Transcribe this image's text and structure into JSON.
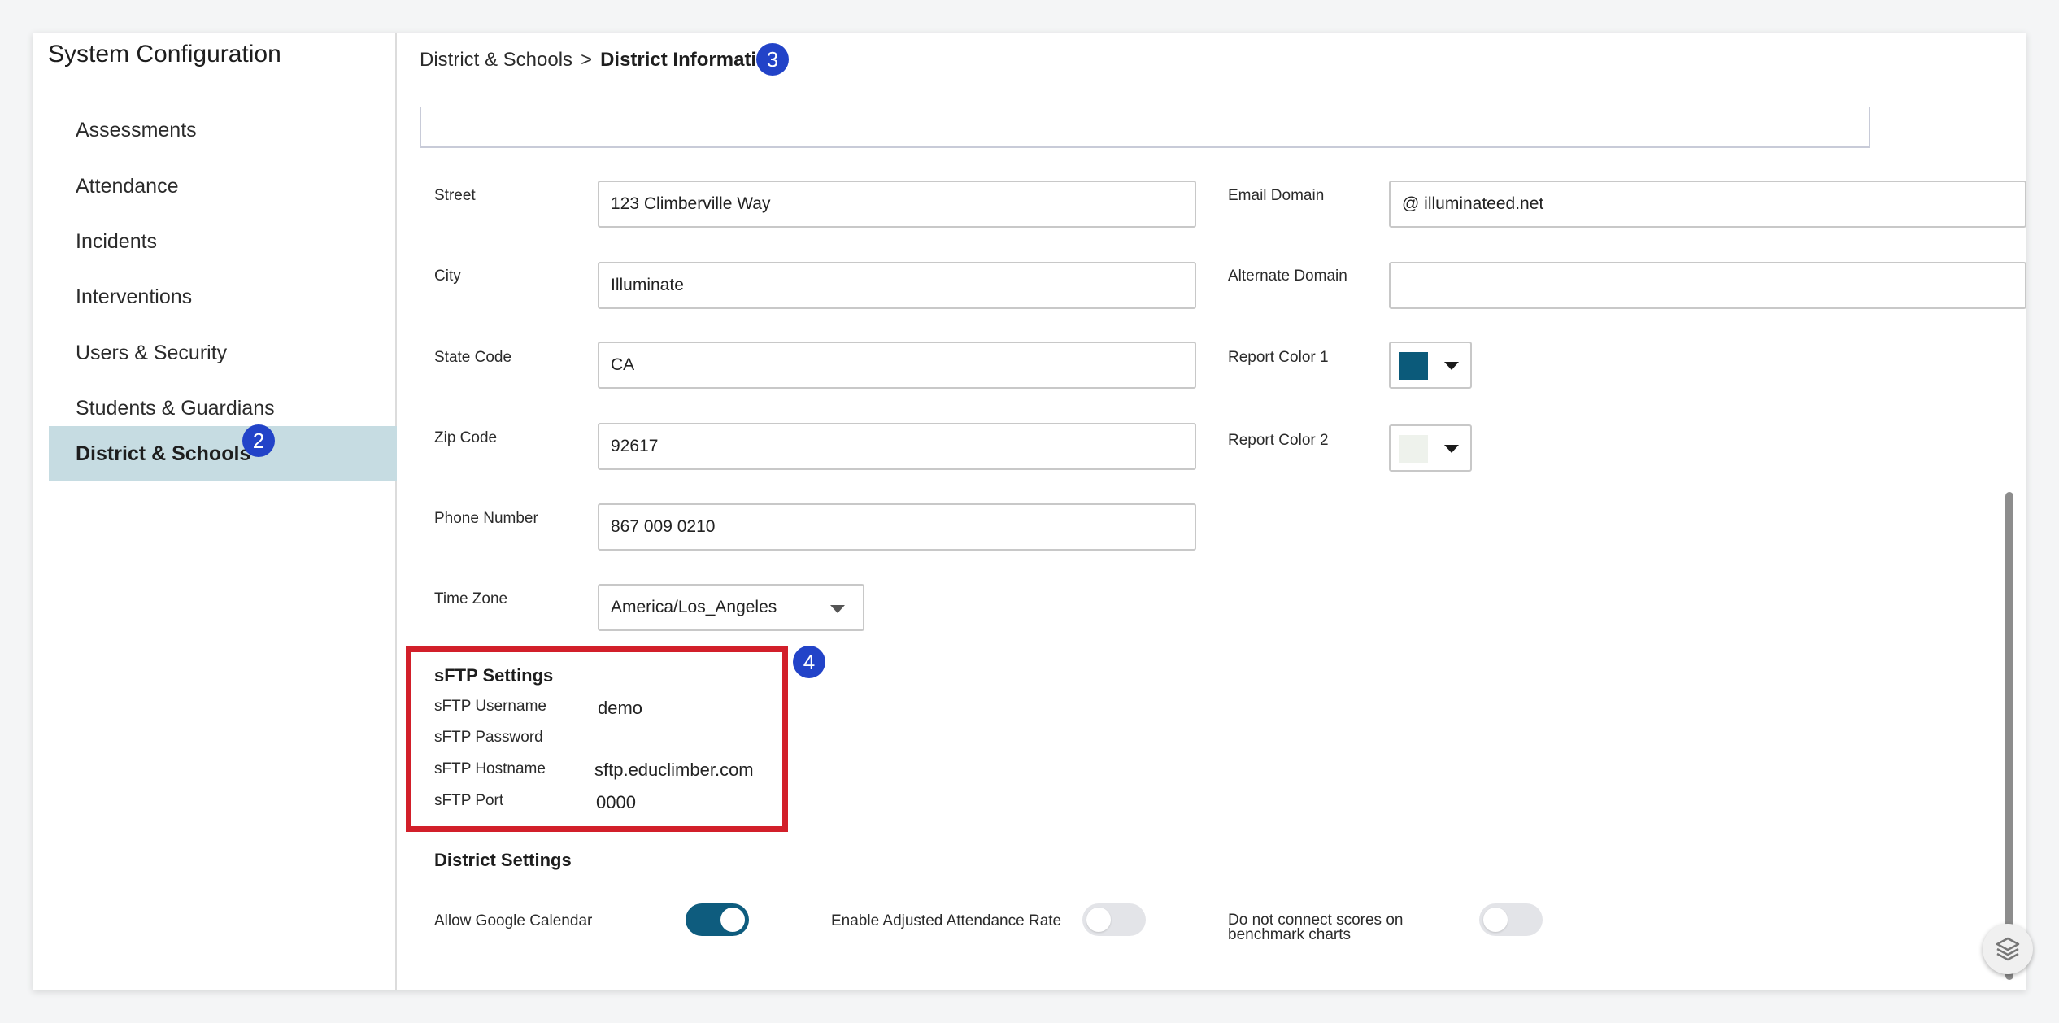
{
  "sidebar": {
    "title": "System Configuration",
    "items": [
      {
        "label": "Assessments"
      },
      {
        "label": "Attendance"
      },
      {
        "label": "Incidents"
      },
      {
        "label": "Interventions"
      },
      {
        "label": "Users & Security"
      },
      {
        "label": "Students & Guardians"
      },
      {
        "label": "District & Schools",
        "active": true,
        "badge": "2"
      }
    ]
  },
  "breadcrumb": {
    "parent": "District & Schools",
    "separator": ">",
    "current": "District Information",
    "badge": "3"
  },
  "form": {
    "street": {
      "label": "Street",
      "value": "123 Climberville Way"
    },
    "city": {
      "label": "City",
      "value": "Illuminate"
    },
    "state": {
      "label": "State Code",
      "value": "CA"
    },
    "zip": {
      "label": "Zip Code",
      "value": "92617"
    },
    "phone": {
      "label": "Phone Number",
      "value": "867 009 0210"
    },
    "timezone": {
      "label": "Time Zone",
      "value": "America/Los_Angeles"
    },
    "email_domain": {
      "label": "Email Domain",
      "value": "@ illuminateed.net"
    },
    "alternate_domain": {
      "label": "Alternate Domain",
      "value": ""
    },
    "report_color_1": {
      "label": "Report Color 1",
      "color": "#0b5a7a"
    },
    "report_color_2": {
      "label": "Report Color 2",
      "color": "#eef2ec"
    }
  },
  "sftp": {
    "title": "sFTP Settings",
    "badge": "4",
    "username_label": "sFTP Username",
    "username": "demo",
    "password_label": "sFTP Password",
    "password": "",
    "hostname_label": "sFTP Hostname",
    "hostname": "sftp.educlimber.com",
    "port_label": "sFTP Port",
    "port": "0000"
  },
  "district_settings": {
    "title": "District Settings",
    "allow_google_calendar": {
      "label": "Allow Google Calendar",
      "on": true
    },
    "adjusted_attendance": {
      "label": "Enable Adjusted Attendance Rate",
      "on": false
    },
    "no_connect_scores": {
      "label_line1": "Do not connect scores on",
      "label_line2": "benchmark charts",
      "on": false
    }
  },
  "colors": {
    "accent": "#0e5c7e",
    "active_nav_bg": "#c6dce2",
    "badge": "#2243c8",
    "highlight_border": "#d21f2a"
  },
  "icons": {
    "dropdown": "chevron-down-icon",
    "fab": "layers-icon"
  }
}
